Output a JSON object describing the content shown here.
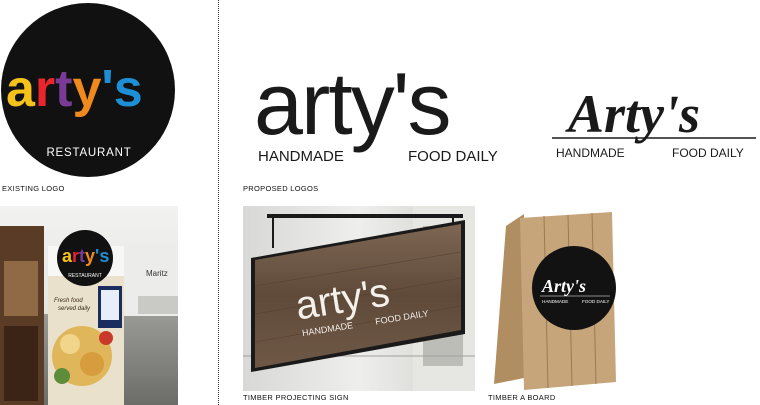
{
  "existing": {
    "wordmark": "arty's",
    "sub": "RESTAURANT",
    "caption": "EXISTING LOGO"
  },
  "proposed": {
    "wordmark": "arty's",
    "wordmark_script": "Arty's",
    "tag_left": "HANDMADE",
    "tag_right": "FOOD DAILY",
    "caption": "PROPOSED LOGOS"
  },
  "photos": {
    "interior_sign_wordmark": "arty's",
    "interior_sign_sub": "RESTAURANT",
    "interior_wall_text": "Maritz",
    "interior_panel_text_1": "Fresh food",
    "interior_panel_text_2": "served daily",
    "projecting_caption": "TIMBER PROJECTING SIGN",
    "aboard_caption": "TIMBER A BOARD"
  },
  "colors": {
    "letter_a": "#f4c21b",
    "letter_r": "#e8262b",
    "letter_t": "#7a3b96",
    "letter_y": "#f08a1c",
    "letter_apos_s": "#1e8fd6",
    "dark": "#1a1a1a",
    "wood": "#6e5846"
  }
}
